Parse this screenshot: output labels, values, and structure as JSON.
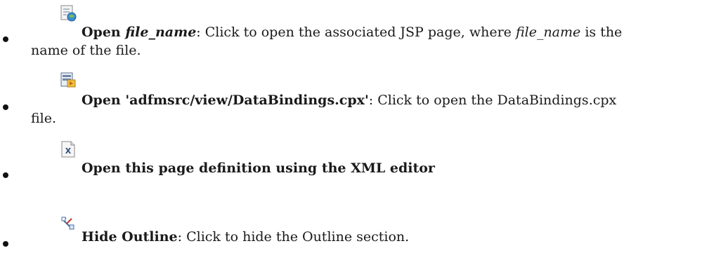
{
  "items": [
    {
      "icon": "open-jsp-page-icon",
      "title_prefix": "Open ",
      "title_italic": "file_name",
      "desc_a": ": Click to open the associated JSP page, where ",
      "desc_italic": "file_name",
      "desc_b": " is the",
      "desc_line2": "name of the file."
    },
    {
      "icon": "open-databindings-icon",
      "title": "Open 'adfmsrc/view/DataBindings.cpx'",
      "desc": ": Click to open the DataBindings.cpx",
      "desc_line2": "file."
    },
    {
      "icon": "xml-editor-icon",
      "title": "Open this page definition using the XML editor"
    },
    {
      "icon": "hide-outline-icon",
      "title": "Hide Outline",
      "desc": ": Click to hide the Outline section."
    }
  ]
}
